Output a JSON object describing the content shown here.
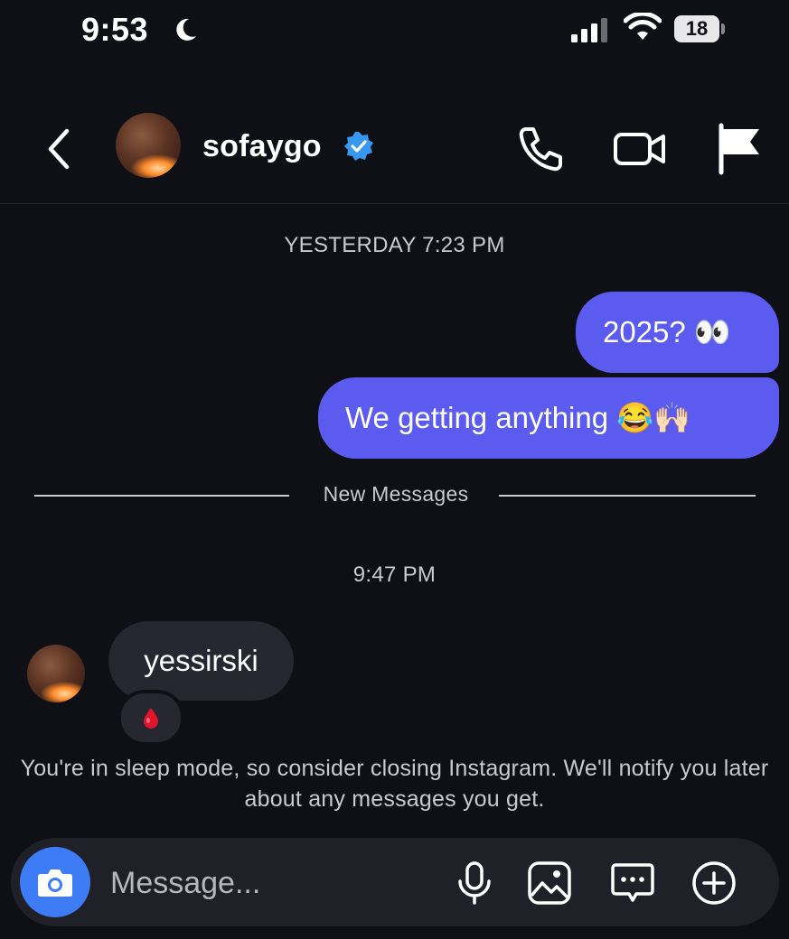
{
  "status_bar": {
    "time": "9:53",
    "battery": "18",
    "icons": [
      "moon-icon",
      "signal-icon",
      "wifi-icon",
      "battery-icon"
    ]
  },
  "header": {
    "contact_name": "sofaygo",
    "verified": true,
    "icons": [
      "back-chevron-icon",
      "phone-icon",
      "video-camera-icon",
      "flag-icon"
    ]
  },
  "conversation": {
    "timestamp_1": "YESTERDAY 7:23 PM",
    "outgoing": [
      {
        "text": "2025? 👀"
      },
      {
        "text": "We getting anything 😂🙌🏻"
      }
    ],
    "new_messages_label": "New Messages",
    "timestamp_2": "9:47 PM",
    "incoming": [
      {
        "text": "yessirski",
        "reaction": "blood-drop"
      }
    ],
    "sleep_notice": "You're in sleep mode, so consider closing Instagram. We'll notify you later about any messages you get."
  },
  "composer": {
    "placeholder": "Message...",
    "icons": [
      "camera-icon",
      "microphone-icon",
      "gallery-icon",
      "sticker-chat-icon",
      "plus-circle-icon"
    ]
  },
  "colors": {
    "background": "#0f1016",
    "outgoing_bubble": "#5b5bf0",
    "incoming_bubble": "#262730",
    "camera_button": "#3e7cf5",
    "verified_badge": "#3897f0"
  }
}
